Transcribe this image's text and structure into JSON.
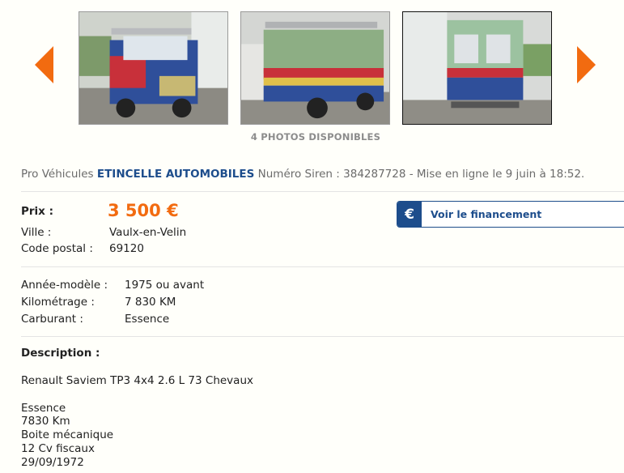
{
  "gallery": {
    "photos_count_label": "4 PHOTOS DISPONIBLES",
    "prev_icon": "chevron-left-icon",
    "next_icon": "chevron-right-icon",
    "accent_color": "#f26b10"
  },
  "seller": {
    "prefix": "Pro Véhicules",
    "name": "ETINCELLE AUTOMOBILES",
    "siren_label": "Numéro Siren :",
    "siren": "384287728",
    "posted": "- Mise en ligne le 9 juin à 18:52."
  },
  "pricing": {
    "price_label": "Prix :",
    "price": "3 500 €",
    "city_label": "Ville :",
    "city": "Vaulx-en-Velin",
    "postal_label": "Code postal :",
    "postal": "69120",
    "finance_icon": "€",
    "finance_label": "Voir le financement"
  },
  "specs": {
    "year_label": "Année-modèle :",
    "year": "1975 ou avant",
    "km_label": "Kilométrage :",
    "km": "7 830 KM",
    "fuel_label": "Carburant :",
    "fuel": "Essence"
  },
  "description": {
    "heading": "Description :",
    "title_line": "Renault Saviem TP3 4x4 2.6 L 73 Chevaux",
    "lines": [
      "Essence",
      "7830 Km",
      "Boite mécanique",
      "12 Cv fiscaux",
      "29/09/1972"
    ]
  },
  "colors": {
    "link_blue": "#1d4d8c",
    "price_orange": "#f26b10"
  }
}
